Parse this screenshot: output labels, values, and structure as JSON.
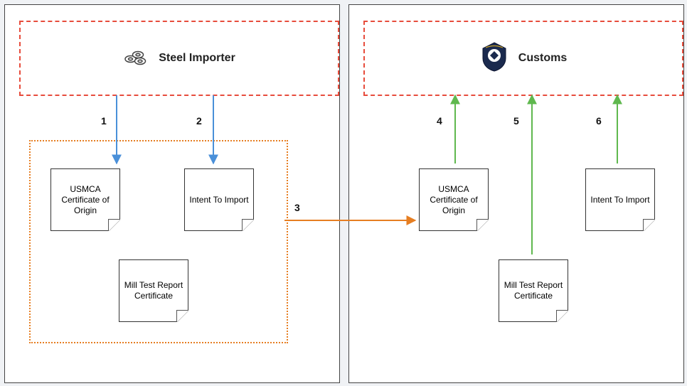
{
  "left": {
    "header": {
      "title": "Steel Importer",
      "icon": "steel-pipes-icon"
    },
    "docs": {
      "usmca": "USMCA Certificate of Origin",
      "intent": "Intent To Import",
      "mtr": "Mill Test Report Certificate"
    }
  },
  "right": {
    "header": {
      "title": "Customs",
      "icon": "cbp-badge-icon"
    },
    "docs": {
      "usmca": "USMCA Certificate of Origin",
      "intent": "Intent To Import",
      "mtr": "Mill Test Report Certificate"
    }
  },
  "steps": {
    "s1": "1",
    "s2": "2",
    "s3": "3",
    "s4": "4",
    "s5": "5",
    "s6": "6"
  },
  "flow": {
    "description": "Steel Importer produces documents (steps 1–2), documents are transferred (step 3), documents are submitted to Customs (steps 4–6).",
    "arrows": [
      {
        "id": 1,
        "from": "Steel Importer",
        "to": "USMCA Certificate of Origin",
        "color": "blue"
      },
      {
        "id": 2,
        "from": "Steel Importer",
        "to": "Intent To Import",
        "color": "blue"
      },
      {
        "id": 3,
        "from": "Left document group",
        "to": "Right document group",
        "color": "orange"
      },
      {
        "id": 4,
        "from": "USMCA Certificate of Origin",
        "to": "Customs",
        "color": "green"
      },
      {
        "id": 5,
        "from": "Mill Test Report Certificate",
        "to": "Customs",
        "color": "green"
      },
      {
        "id": 6,
        "from": "Intent To Import",
        "to": "Customs",
        "color": "green"
      }
    ]
  },
  "colors": {
    "blue": "#4a90d9",
    "green": "#5fb84e",
    "orange": "#e67e22",
    "red": "#e74c3c"
  }
}
